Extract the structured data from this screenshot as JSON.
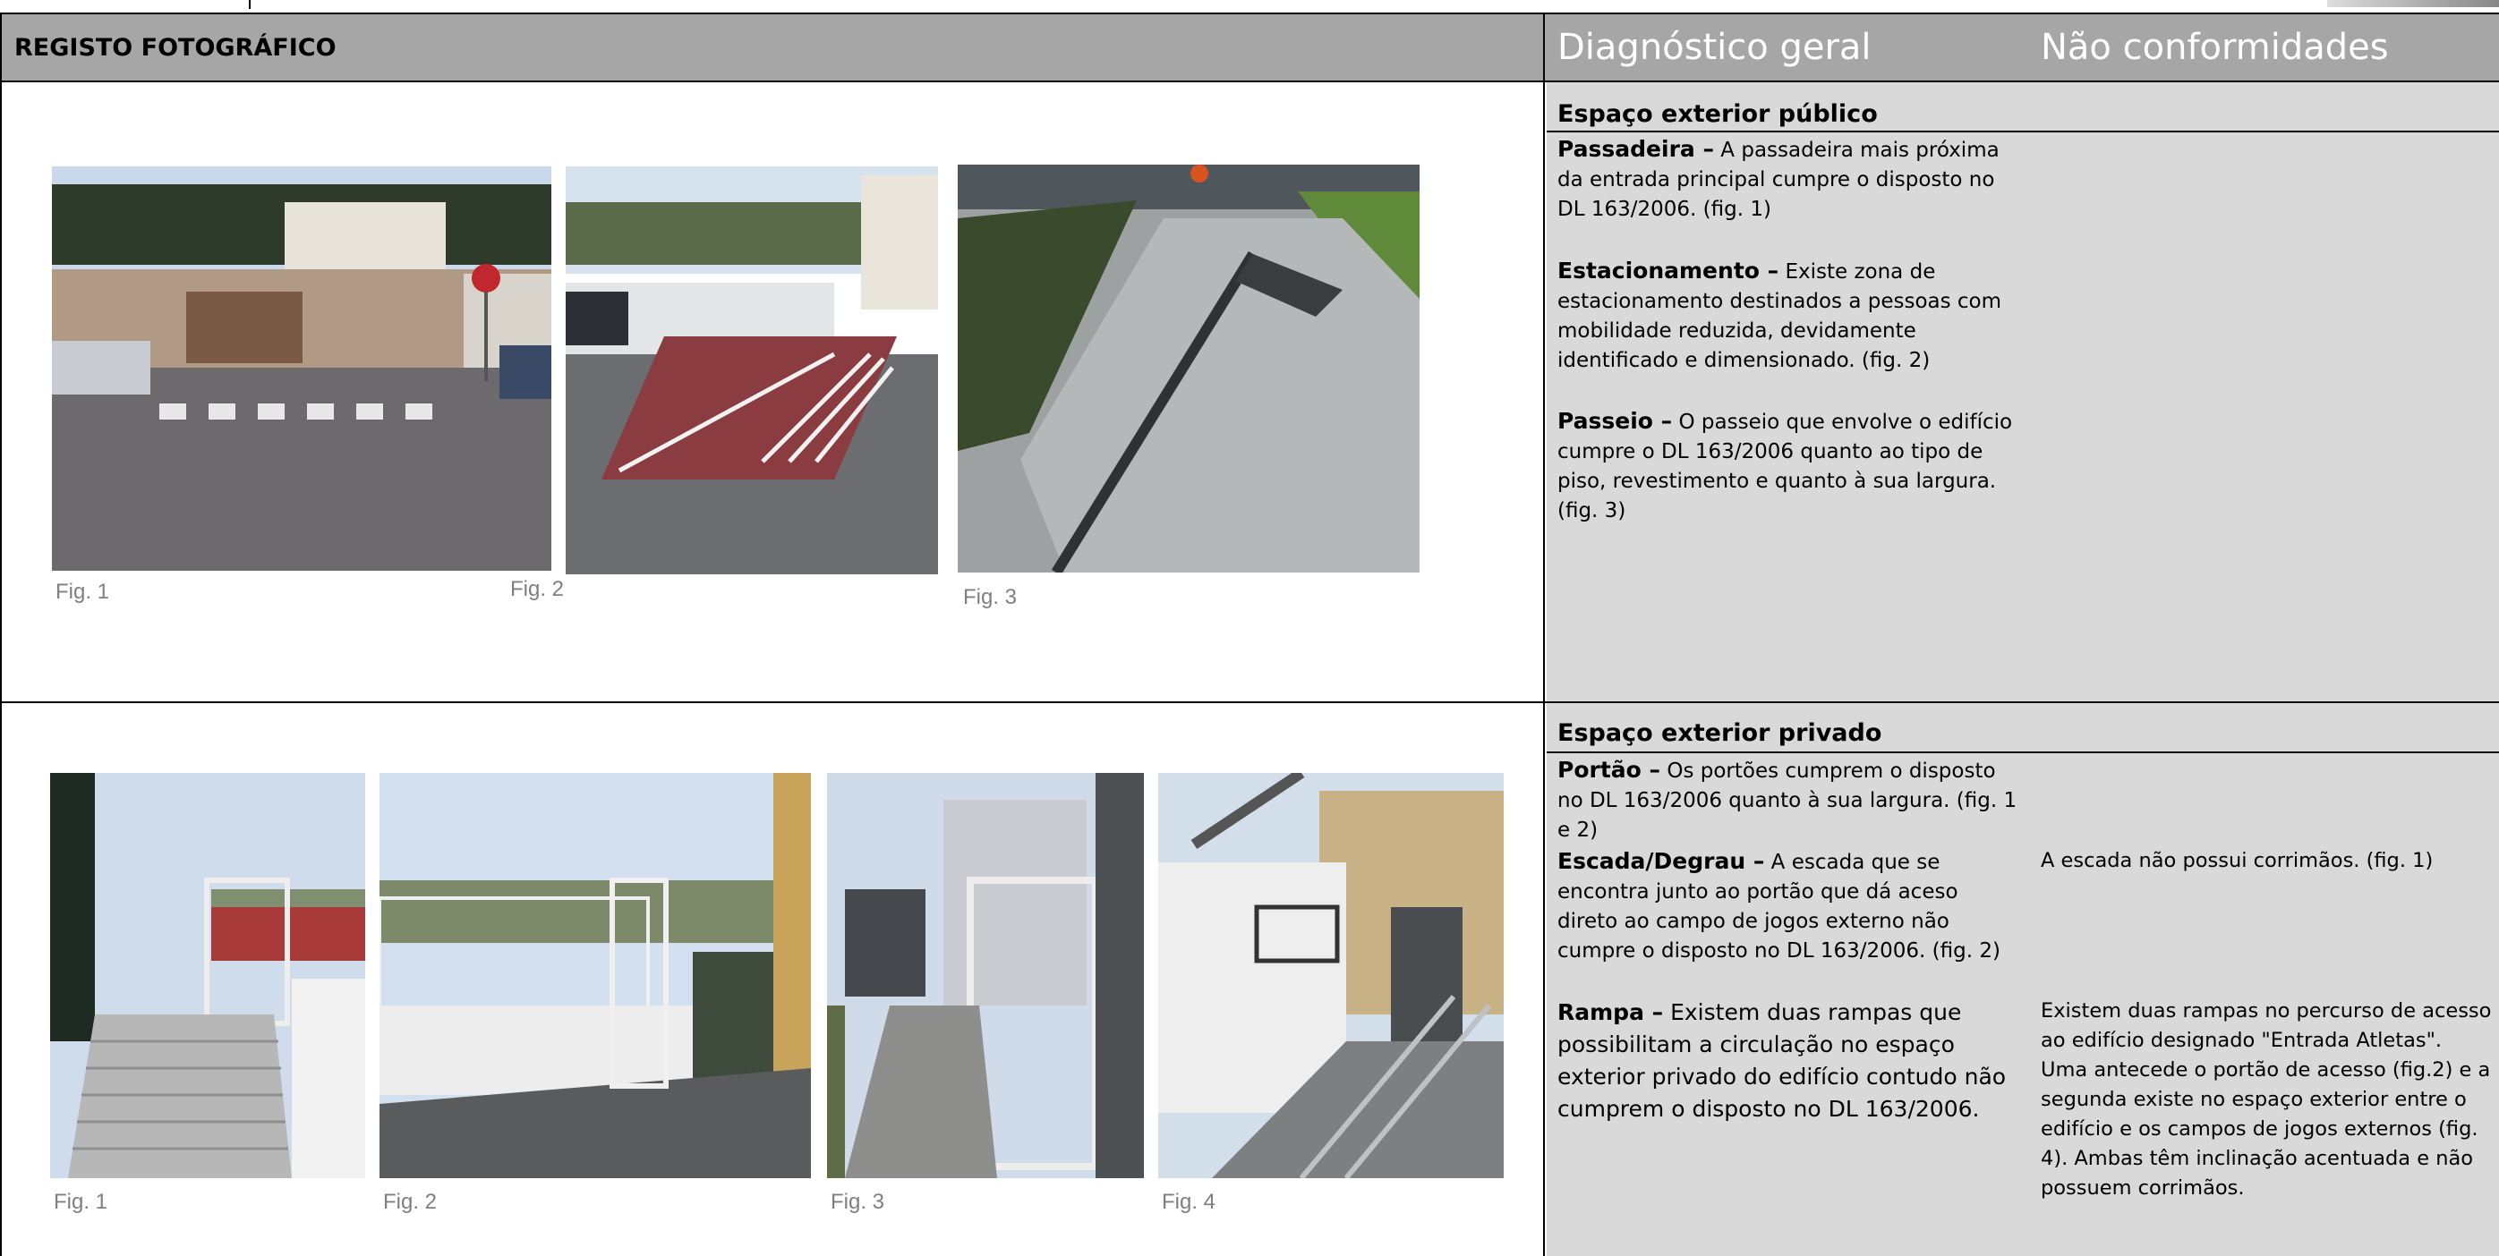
{
  "header": {
    "left_title": "REGISTO FOTOGRÁFICO",
    "diagnostico": "Diagnóstico geral",
    "nao_conformidades": "Não conformidades"
  },
  "section1": {
    "title": "Espaço exterior público",
    "captions": [
      "Fig. 1",
      "Fig. 2",
      "Fig. 3"
    ],
    "items": [
      {
        "label": "Passadeira –",
        "text": " A passadeira mais próxima da entrada principal cumpre o disposto no DL 163/2006. (fig. 1)"
      },
      {
        "label": "Estacionamento –",
        "text": " Existe zona de estacionamento destinados a pessoas com mobilidade reduzida, devidamente identificado e dimensionado. (fig. 2)"
      },
      {
        "label": "Passeio –",
        "text": " O passeio que envolve o edifício cumpre o DL 163/2006 quanto ao tipo de piso, revestimento e quanto à sua largura. (fig. 3)"
      }
    ]
  },
  "section2": {
    "title": "Espaço exterior privado",
    "captions": [
      "Fig. 1",
      "Fig. 2",
      "Fig. 3",
      "Fig. 4"
    ],
    "items": [
      {
        "label": "Portão –",
        "text": " Os portões cumprem o disposto no DL 163/2006 quanto à sua largura. (fig. 1 e 2)"
      },
      {
        "label": "Escada/Degrau –",
        "text": " A escada que se encontra junto ao portão que dá aceso direto ao campo de jogos externo não cumpre o disposto no DL 163/2006. (fig. 2)"
      },
      {
        "label": "Rampa –",
        "text": " Existem duas rampas que possibilitam a circulação no espaço exterior privado do edifício contudo não cumprem o disposto no DL 163/2006."
      }
    ],
    "non_conformities": [
      "A escada não possui corrimãos. (fig. 1)",
      "Existem duas rampas no percurso de acesso ao edifício designado \"Entrada Atletas\". Uma antecede o portão de acesso (fig.2) e a segunda existe no espaço exterior entre o edifício e os campos de jogos externos (fig. 4). Ambas têm inclinação acentuada e não possuem corrimãos."
    ]
  }
}
